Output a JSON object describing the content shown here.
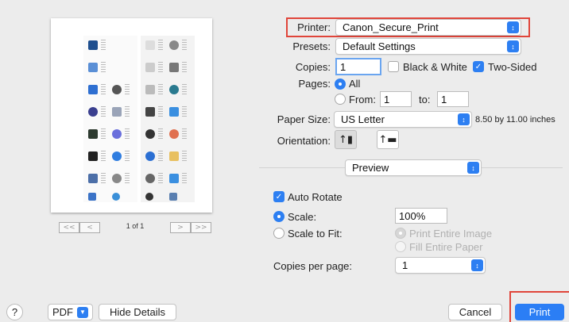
{
  "printer": {
    "label": "Printer:",
    "value": "Canon_Secure_Print"
  },
  "presets": {
    "label": "Presets:",
    "value": "Default Settings"
  },
  "copies": {
    "label": "Copies:",
    "value": "1",
    "bw_label": "Black & White",
    "bw_checked": false,
    "twosided_label": "Two-Sided",
    "twosided_checked": true
  },
  "pages": {
    "label": "Pages:",
    "all_label": "All",
    "from_label": "From:",
    "from_value": "1",
    "to_label": "to:",
    "to_value": "1"
  },
  "paper_size": {
    "label": "Paper Size:",
    "value": "US Letter",
    "dimensions": "8.50 by 11.00 inches"
  },
  "orientation": {
    "label": "Orientation:",
    "portrait_icon": "portrait-orientation-icon",
    "landscape_icon": "landscape-orientation-icon"
  },
  "section_popup": {
    "value": "Preview"
  },
  "auto_rotate": {
    "label": "Auto Rotate",
    "checked": true
  },
  "scale": {
    "label": "Scale:",
    "value": "100%"
  },
  "scale_to_fit": {
    "label": "Scale to Fit:",
    "opt1": "Print Entire Image",
    "opt2": "Fill Entire Paper"
  },
  "copies_per_page": {
    "label": "Copies per page:",
    "value": "1"
  },
  "preview_nav": {
    "first": "<<",
    "prev": "<",
    "next": ">",
    "last": ">>",
    "page_label": "1 of 1"
  },
  "bottom": {
    "help": "?",
    "pdf": "PDF",
    "hide_details": "Hide Details",
    "cancel": "Cancel",
    "print": "Print"
  },
  "colors": {
    "accent": "#2b7ef5",
    "highlight": "#e0453a"
  }
}
